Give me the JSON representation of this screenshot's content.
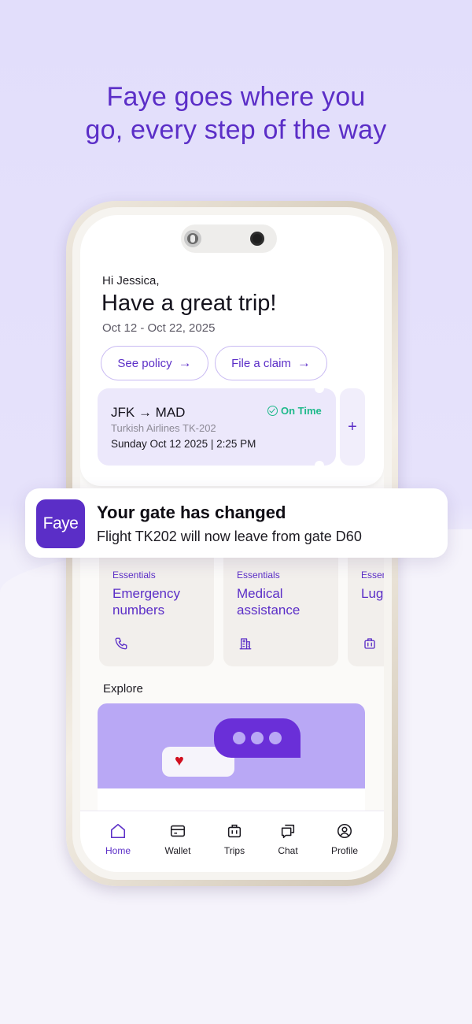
{
  "headline": {
    "line1": "Faye goes where you",
    "line2": "go, every step of the way"
  },
  "colors": {
    "brand": "#5b2ec7",
    "on_time": "#1eb98a",
    "background": "#e2defb"
  },
  "home": {
    "greeting": "Hi Jessica,",
    "title": "Have a great trip!",
    "dates": "Oct 12 - Oct 22, 2025",
    "buttons": {
      "see_policy": "See policy",
      "file_claim": "File a claim",
      "arrow": "→"
    },
    "flight": {
      "route": "JFK → MAD",
      "airline": "Turkish Airlines TK-202",
      "departure": "Sunday Oct 12 2025 | 2:25 PM",
      "status": "On Time",
      "status_icon": "check-circle-icon",
      "add_symbol": "+"
    },
    "essentials": [
      {
        "tag": "Essentials",
        "title": "Emergency numbers",
        "icon": "phone-icon"
      },
      {
        "tag": "Essentials",
        "title": "Medical assistance",
        "icon": "hospital-icon"
      },
      {
        "tag": "Essen",
        "title": "Lug assi",
        "icon": "luggage-icon"
      }
    ],
    "explore": {
      "label": "Explore",
      "heart": "♥"
    }
  },
  "tabs": [
    {
      "label": "Home",
      "icon": "home-icon",
      "active": true
    },
    {
      "label": "Wallet",
      "icon": "wallet-icon",
      "active": false
    },
    {
      "label": "Trips",
      "icon": "suitcase-icon",
      "active": false
    },
    {
      "label": "Chat",
      "icon": "chat-icon",
      "active": false
    },
    {
      "label": "Profile",
      "icon": "profile-icon",
      "active": false
    }
  ],
  "notification": {
    "app_name": "Faye",
    "title": "Your gate has changed",
    "body": "Flight TK202 will now leave from gate D60"
  }
}
